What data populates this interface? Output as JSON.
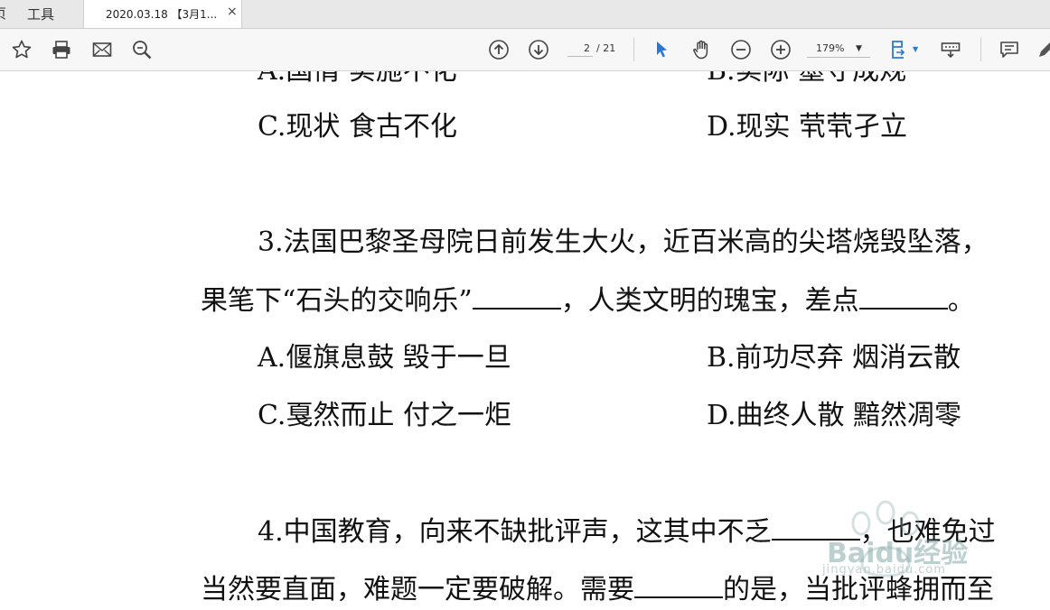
{
  "tabs": {
    "partial_label": "页",
    "tools_label": "工具",
    "doc_title": "2020.03.18 【3月1...",
    "close_symbol": "×"
  },
  "toolbar": {
    "current_page": "2",
    "total_pages": "/ 21",
    "zoom": "179%",
    "icons": [
      "star-icon",
      "print-icon",
      "mail-icon",
      "search-icon",
      "arrow-up-circle-icon",
      "arrow-down-circle-icon",
      "select-cursor-icon",
      "hand-icon",
      "zoom-out-icon",
      "zoom-in-icon",
      "fit-page-icon",
      "toolbar-toggle-icon",
      "comment-icon",
      "pen-icon"
    ],
    "accent": "#2b78d4"
  },
  "document": {
    "q2_optA_left": "A.国情  实施不化",
    "q2_optB_left": "B.实际  墨守成规",
    "q2_optC": "C.现状  食古不化",
    "q2_optD": "D.现实  茕茕孑立",
    "q3_line1": "3.法国巴黎圣母院日前发生大火，近百米高的尖塔烧毁坠落，",
    "q3_line2_a": "果笔下“石头的交响乐”",
    "q3_line2_b": "，人类文明的瑰宝，差点",
    "q3_line2_c": "。",
    "q3_optA": "A.偃旗息鼓  毁于一旦",
    "q3_optB": "B.前功尽弃  烟消云散",
    "q3_optC": "C.戛然而止  付之一炬",
    "q3_optD": "D.曲终人散  黯然凋零",
    "q4_line1": "4.中国教育，向来不缺批评声，这其中不乏",
    "q4_line1_b": "，也难免过",
    "q4_line2_a": "当然要直面，难题一定要破解。需要",
    "q4_line2_b": "的是，当批评蜂拥而至"
  },
  "watermark": {
    "brand": "Baidu经验",
    "url": "jingyan.baidu.com"
  }
}
